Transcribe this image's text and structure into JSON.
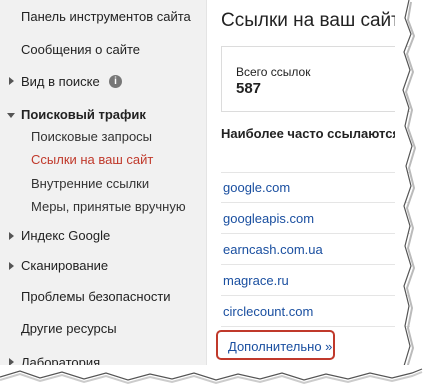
{
  "sidebar": {
    "dashboard": "Панель инструментов сайта",
    "messages": "Сообщения о сайте",
    "search_appearance": "Вид в поиске",
    "search_traffic": "Поисковый трафик",
    "search_traffic_items": [
      "Поисковые запросы",
      "Ссылки на ваш сайт",
      "Внутренние ссылки",
      "Меры, принятые вручную"
    ],
    "google_index": "Индекс Google",
    "crawl": "Сканирование",
    "security": "Проблемы безопасности",
    "other": "Другие ресурсы",
    "labs": "Лаборатория",
    "info_icon": "i"
  },
  "main": {
    "title": "Ссылки на ваш сайт",
    "total_label": "Всего ссылок",
    "total_value": "587",
    "section_title": "Наиболее часто ссылаются",
    "domains": [
      "google.com",
      "googleapis.com",
      "earncash.com.ua",
      "magrace.ru",
      "circlecount.com"
    ],
    "more_label": "Дополнительно »"
  },
  "colors": {
    "active": "#c0392b",
    "link": "#1a4fa0",
    "highlight_border": "#c0392b"
  }
}
